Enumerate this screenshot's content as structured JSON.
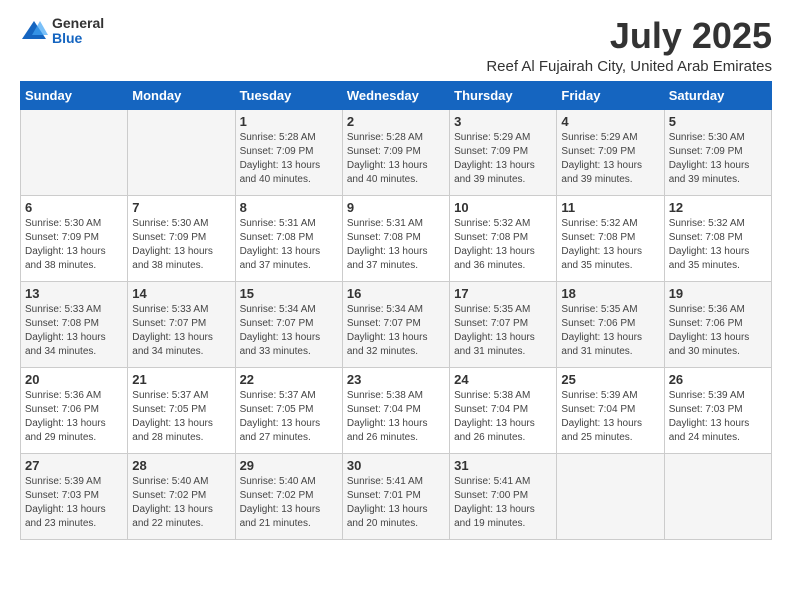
{
  "header": {
    "logo_general": "General",
    "logo_blue": "Blue",
    "title": "July 2025",
    "subtitle": "Reef Al Fujairah City, United Arab Emirates"
  },
  "days_of_week": [
    "Sunday",
    "Monday",
    "Tuesday",
    "Wednesday",
    "Thursday",
    "Friday",
    "Saturday"
  ],
  "weeks": [
    [
      {
        "day": "",
        "info": ""
      },
      {
        "day": "",
        "info": ""
      },
      {
        "day": "1",
        "info": "Sunrise: 5:28 AM\nSunset: 7:09 PM\nDaylight: 13 hours and 40 minutes."
      },
      {
        "day": "2",
        "info": "Sunrise: 5:28 AM\nSunset: 7:09 PM\nDaylight: 13 hours and 40 minutes."
      },
      {
        "day": "3",
        "info": "Sunrise: 5:29 AM\nSunset: 7:09 PM\nDaylight: 13 hours and 39 minutes."
      },
      {
        "day": "4",
        "info": "Sunrise: 5:29 AM\nSunset: 7:09 PM\nDaylight: 13 hours and 39 minutes."
      },
      {
        "day": "5",
        "info": "Sunrise: 5:30 AM\nSunset: 7:09 PM\nDaylight: 13 hours and 39 minutes."
      }
    ],
    [
      {
        "day": "6",
        "info": "Sunrise: 5:30 AM\nSunset: 7:09 PM\nDaylight: 13 hours and 38 minutes."
      },
      {
        "day": "7",
        "info": "Sunrise: 5:30 AM\nSunset: 7:09 PM\nDaylight: 13 hours and 38 minutes."
      },
      {
        "day": "8",
        "info": "Sunrise: 5:31 AM\nSunset: 7:08 PM\nDaylight: 13 hours and 37 minutes."
      },
      {
        "day": "9",
        "info": "Sunrise: 5:31 AM\nSunset: 7:08 PM\nDaylight: 13 hours and 37 minutes."
      },
      {
        "day": "10",
        "info": "Sunrise: 5:32 AM\nSunset: 7:08 PM\nDaylight: 13 hours and 36 minutes."
      },
      {
        "day": "11",
        "info": "Sunrise: 5:32 AM\nSunset: 7:08 PM\nDaylight: 13 hours and 35 minutes."
      },
      {
        "day": "12",
        "info": "Sunrise: 5:32 AM\nSunset: 7:08 PM\nDaylight: 13 hours and 35 minutes."
      }
    ],
    [
      {
        "day": "13",
        "info": "Sunrise: 5:33 AM\nSunset: 7:08 PM\nDaylight: 13 hours and 34 minutes."
      },
      {
        "day": "14",
        "info": "Sunrise: 5:33 AM\nSunset: 7:07 PM\nDaylight: 13 hours and 34 minutes."
      },
      {
        "day": "15",
        "info": "Sunrise: 5:34 AM\nSunset: 7:07 PM\nDaylight: 13 hours and 33 minutes."
      },
      {
        "day": "16",
        "info": "Sunrise: 5:34 AM\nSunset: 7:07 PM\nDaylight: 13 hours and 32 minutes."
      },
      {
        "day": "17",
        "info": "Sunrise: 5:35 AM\nSunset: 7:07 PM\nDaylight: 13 hours and 31 minutes."
      },
      {
        "day": "18",
        "info": "Sunrise: 5:35 AM\nSunset: 7:06 PM\nDaylight: 13 hours and 31 minutes."
      },
      {
        "day": "19",
        "info": "Sunrise: 5:36 AM\nSunset: 7:06 PM\nDaylight: 13 hours and 30 minutes."
      }
    ],
    [
      {
        "day": "20",
        "info": "Sunrise: 5:36 AM\nSunset: 7:06 PM\nDaylight: 13 hours and 29 minutes."
      },
      {
        "day": "21",
        "info": "Sunrise: 5:37 AM\nSunset: 7:05 PM\nDaylight: 13 hours and 28 minutes."
      },
      {
        "day": "22",
        "info": "Sunrise: 5:37 AM\nSunset: 7:05 PM\nDaylight: 13 hours and 27 minutes."
      },
      {
        "day": "23",
        "info": "Sunrise: 5:38 AM\nSunset: 7:04 PM\nDaylight: 13 hours and 26 minutes."
      },
      {
        "day": "24",
        "info": "Sunrise: 5:38 AM\nSunset: 7:04 PM\nDaylight: 13 hours and 26 minutes."
      },
      {
        "day": "25",
        "info": "Sunrise: 5:39 AM\nSunset: 7:04 PM\nDaylight: 13 hours and 25 minutes."
      },
      {
        "day": "26",
        "info": "Sunrise: 5:39 AM\nSunset: 7:03 PM\nDaylight: 13 hours and 24 minutes."
      }
    ],
    [
      {
        "day": "27",
        "info": "Sunrise: 5:39 AM\nSunset: 7:03 PM\nDaylight: 13 hours and 23 minutes."
      },
      {
        "day": "28",
        "info": "Sunrise: 5:40 AM\nSunset: 7:02 PM\nDaylight: 13 hours and 22 minutes."
      },
      {
        "day": "29",
        "info": "Sunrise: 5:40 AM\nSunset: 7:02 PM\nDaylight: 13 hours and 21 minutes."
      },
      {
        "day": "30",
        "info": "Sunrise: 5:41 AM\nSunset: 7:01 PM\nDaylight: 13 hours and 20 minutes."
      },
      {
        "day": "31",
        "info": "Sunrise: 5:41 AM\nSunset: 7:00 PM\nDaylight: 13 hours and 19 minutes."
      },
      {
        "day": "",
        "info": ""
      },
      {
        "day": "",
        "info": ""
      }
    ]
  ]
}
